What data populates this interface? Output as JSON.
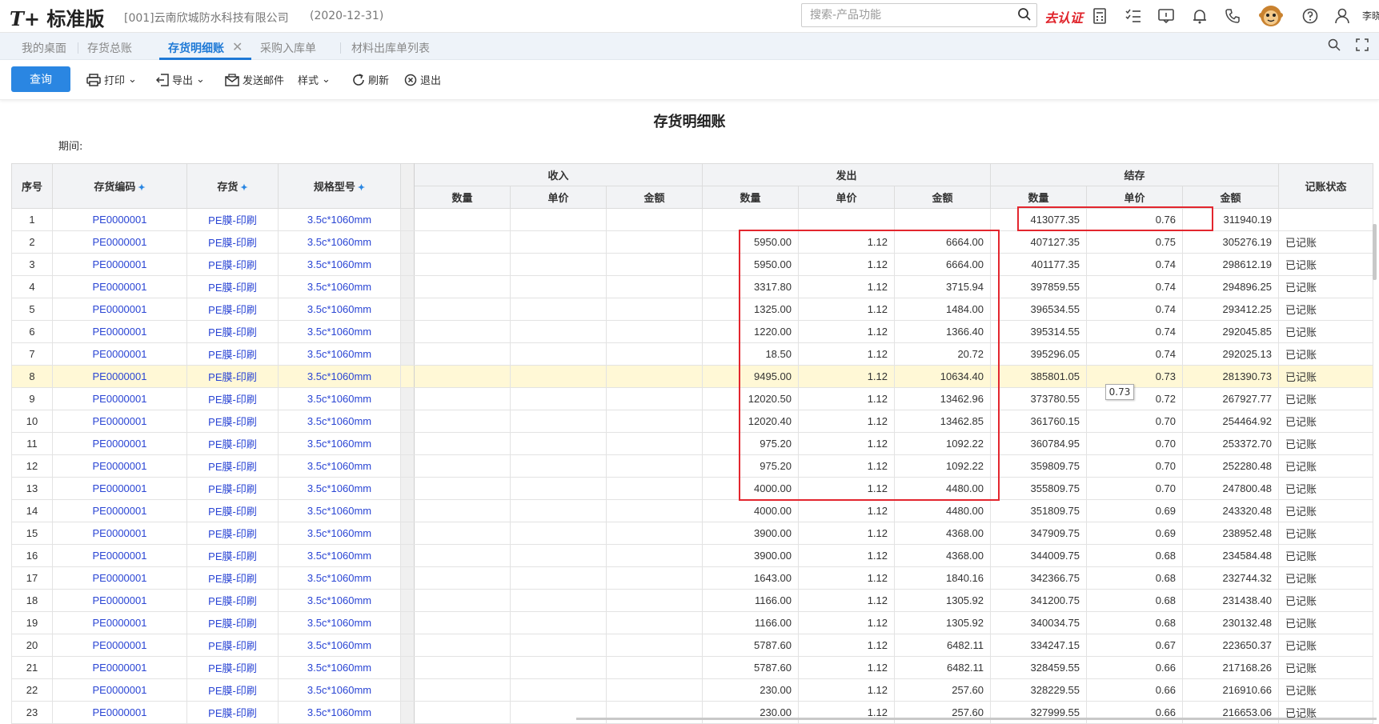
{
  "app": {
    "logo_prefix": "T+",
    "logo_text": "标准版",
    "company": "[001]云南欣城防水科技有限公司",
    "date": "(2020-12-31)",
    "search_placeholder": "搜索-产品功能",
    "cert_label": "去认证",
    "username": "李晓"
  },
  "tabs": [
    {
      "label": "我的桌面",
      "active": false
    },
    {
      "label": "存货总账",
      "active": false
    },
    {
      "label": "存货明细账",
      "active": true
    },
    {
      "label": "采购入库单",
      "active": false
    },
    {
      "label": "材料出库单列表",
      "active": false
    }
  ],
  "toolbar": {
    "query": "查询",
    "print": "打印",
    "export": "导出",
    "email": "发送邮件",
    "style": "样式",
    "refresh": "刷新",
    "exit": "退出"
  },
  "report": {
    "title": "存货明细账",
    "period_label": "期间:"
  },
  "table": {
    "headers": {
      "seq": "序号",
      "code": "存货编码",
      "item": "存货",
      "spec": "规格型号",
      "receive": "收入",
      "issue": "发出",
      "balance": "结存",
      "status": "记账状态",
      "qty": "数量",
      "price": "单价",
      "amount": "金额"
    },
    "rows": [
      {
        "seq": "1",
        "code": "PE0000001",
        "item": "PE膜-印刷",
        "spec": "3.5c*1060mm",
        "out_qty": "",
        "out_price": "",
        "out_amt": "",
        "bal_qty": "413077.35",
        "bal_price": "0.76",
        "bal_amt": "311940.19",
        "status": ""
      },
      {
        "seq": "2",
        "code": "PE0000001",
        "item": "PE膜-印刷",
        "spec": "3.5c*1060mm",
        "out_qty": "5950.00",
        "out_price": "1.12",
        "out_amt": "6664.00",
        "bal_qty": "407127.35",
        "bal_price": "0.75",
        "bal_amt": "305276.19",
        "status": "已记账"
      },
      {
        "seq": "3",
        "code": "PE0000001",
        "item": "PE膜-印刷",
        "spec": "3.5c*1060mm",
        "out_qty": "5950.00",
        "out_price": "1.12",
        "out_amt": "6664.00",
        "bal_qty": "401177.35",
        "bal_price": "0.74",
        "bal_amt": "298612.19",
        "status": "已记账"
      },
      {
        "seq": "4",
        "code": "PE0000001",
        "item": "PE膜-印刷",
        "spec": "3.5c*1060mm",
        "out_qty": "3317.80",
        "out_price": "1.12",
        "out_amt": "3715.94",
        "bal_qty": "397859.55",
        "bal_price": "0.74",
        "bal_amt": "294896.25",
        "status": "已记账"
      },
      {
        "seq": "5",
        "code": "PE0000001",
        "item": "PE膜-印刷",
        "spec": "3.5c*1060mm",
        "out_qty": "1325.00",
        "out_price": "1.12",
        "out_amt": "1484.00",
        "bal_qty": "396534.55",
        "bal_price": "0.74",
        "bal_amt": "293412.25",
        "status": "已记账"
      },
      {
        "seq": "6",
        "code": "PE0000001",
        "item": "PE膜-印刷",
        "spec": "3.5c*1060mm",
        "out_qty": "1220.00",
        "out_price": "1.12",
        "out_amt": "1366.40",
        "bal_qty": "395314.55",
        "bal_price": "0.74",
        "bal_amt": "292045.85",
        "status": "已记账"
      },
      {
        "seq": "7",
        "code": "PE0000001",
        "item": "PE膜-印刷",
        "spec": "3.5c*1060mm",
        "out_qty": "18.50",
        "out_price": "1.12",
        "out_amt": "20.72",
        "bal_qty": "395296.05",
        "bal_price": "0.74",
        "bal_amt": "292025.13",
        "status": "已记账"
      },
      {
        "seq": "8",
        "code": "PE0000001",
        "item": "PE膜-印刷",
        "spec": "3.5c*1060mm",
        "out_qty": "9495.00",
        "out_price": "1.12",
        "out_amt": "10634.40",
        "bal_qty": "385801.05",
        "bal_price": "0.73",
        "bal_amt": "281390.73",
        "status": "已记账",
        "highlight": true
      },
      {
        "seq": "9",
        "code": "PE0000001",
        "item": "PE膜-印刷",
        "spec": "3.5c*1060mm",
        "out_qty": "12020.50",
        "out_price": "1.12",
        "out_amt": "13462.96",
        "bal_qty": "373780.55",
        "bal_price": "0.72",
        "bal_amt": "267927.77",
        "status": "已记账"
      },
      {
        "seq": "10",
        "code": "PE0000001",
        "item": "PE膜-印刷",
        "spec": "3.5c*1060mm",
        "out_qty": "12020.40",
        "out_price": "1.12",
        "out_amt": "13462.85",
        "bal_qty": "361760.15",
        "bal_price": "0.70",
        "bal_amt": "254464.92",
        "status": "已记账"
      },
      {
        "seq": "11",
        "code": "PE0000001",
        "item": "PE膜-印刷",
        "spec": "3.5c*1060mm",
        "out_qty": "975.20",
        "out_price": "1.12",
        "out_amt": "1092.22",
        "bal_qty": "360784.95",
        "bal_price": "0.70",
        "bal_amt": "253372.70",
        "status": "已记账"
      },
      {
        "seq": "12",
        "code": "PE0000001",
        "item": "PE膜-印刷",
        "spec": "3.5c*1060mm",
        "out_qty": "975.20",
        "out_price": "1.12",
        "out_amt": "1092.22",
        "bal_qty": "359809.75",
        "bal_price": "0.70",
        "bal_amt": "252280.48",
        "status": "已记账"
      },
      {
        "seq": "13",
        "code": "PE0000001",
        "item": "PE膜-印刷",
        "spec": "3.5c*1060mm",
        "out_qty": "4000.00",
        "out_price": "1.12",
        "out_amt": "4480.00",
        "bal_qty": "355809.75",
        "bal_price": "0.70",
        "bal_amt": "247800.48",
        "status": "已记账"
      },
      {
        "seq": "14",
        "code": "PE0000001",
        "item": "PE膜-印刷",
        "spec": "3.5c*1060mm",
        "out_qty": "4000.00",
        "out_price": "1.12",
        "out_amt": "4480.00",
        "bal_qty": "351809.75",
        "bal_price": "0.69",
        "bal_amt": "243320.48",
        "status": "已记账"
      },
      {
        "seq": "15",
        "code": "PE0000001",
        "item": "PE膜-印刷",
        "spec": "3.5c*1060mm",
        "out_qty": "3900.00",
        "out_price": "1.12",
        "out_amt": "4368.00",
        "bal_qty": "347909.75",
        "bal_price": "0.69",
        "bal_amt": "238952.48",
        "status": "已记账"
      },
      {
        "seq": "16",
        "code": "PE0000001",
        "item": "PE膜-印刷",
        "spec": "3.5c*1060mm",
        "out_qty": "3900.00",
        "out_price": "1.12",
        "out_amt": "4368.00",
        "bal_qty": "344009.75",
        "bal_price": "0.68",
        "bal_amt": "234584.48",
        "status": "已记账"
      },
      {
        "seq": "17",
        "code": "PE0000001",
        "item": "PE膜-印刷",
        "spec": "3.5c*1060mm",
        "out_qty": "1643.00",
        "out_price": "1.12",
        "out_amt": "1840.16",
        "bal_qty": "342366.75",
        "bal_price": "0.68",
        "bal_amt": "232744.32",
        "status": "已记账"
      },
      {
        "seq": "18",
        "code": "PE0000001",
        "item": "PE膜-印刷",
        "spec": "3.5c*1060mm",
        "out_qty": "1166.00",
        "out_price": "1.12",
        "out_amt": "1305.92",
        "bal_qty": "341200.75",
        "bal_price": "0.68",
        "bal_amt": "231438.40",
        "status": "已记账"
      },
      {
        "seq": "19",
        "code": "PE0000001",
        "item": "PE膜-印刷",
        "spec": "3.5c*1060mm",
        "out_qty": "1166.00",
        "out_price": "1.12",
        "out_amt": "1305.92",
        "bal_qty": "340034.75",
        "bal_price": "0.68",
        "bal_amt": "230132.48",
        "status": "已记账"
      },
      {
        "seq": "20",
        "code": "PE0000001",
        "item": "PE膜-印刷",
        "spec": "3.5c*1060mm",
        "out_qty": "5787.60",
        "out_price": "1.12",
        "out_amt": "6482.11",
        "bal_qty": "334247.15",
        "bal_price": "0.67",
        "bal_amt": "223650.37",
        "status": "已记账"
      },
      {
        "seq": "21",
        "code": "PE0000001",
        "item": "PE膜-印刷",
        "spec": "3.5c*1060mm",
        "out_qty": "5787.60",
        "out_price": "1.12",
        "out_amt": "6482.11",
        "bal_qty": "328459.55",
        "bal_price": "0.66",
        "bal_amt": "217168.26",
        "status": "已记账"
      },
      {
        "seq": "22",
        "code": "PE0000001",
        "item": "PE膜-印刷",
        "spec": "3.5c*1060mm",
        "out_qty": "230.00",
        "out_price": "1.12",
        "out_amt": "257.60",
        "bal_qty": "328229.55",
        "bal_price": "0.66",
        "bal_amt": "216910.66",
        "status": "已记账"
      },
      {
        "seq": "23",
        "code": "PE0000001",
        "item": "PE膜-印刷",
        "spec": "3.5c*1060mm",
        "out_qty": "230.00",
        "out_price": "1.12",
        "out_amt": "257.60",
        "bal_qty": "327999.55",
        "bal_price": "0.66",
        "bal_amt": "216653.06",
        "status": "已记账"
      }
    ]
  },
  "tooltip_value": "0.73",
  "colors": {
    "accent": "#2a86e2",
    "link": "#2a45d4",
    "annotation_red": "#e3262e",
    "row_highlight": "#fff8d6"
  }
}
